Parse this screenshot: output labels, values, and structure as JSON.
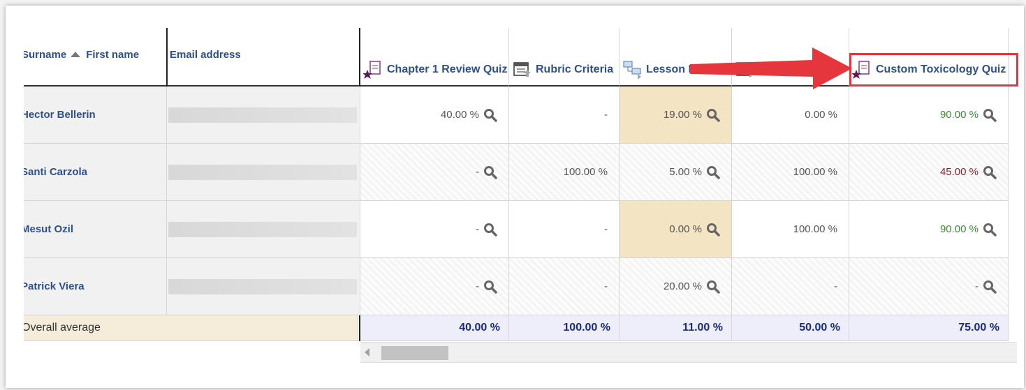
{
  "table": {
    "header": {
      "surname": "Surname",
      "first_name": "First name",
      "email": "Email address",
      "columns": [
        {
          "name": "Chapter 1 Review Quiz",
          "icon": "quiz-icon"
        },
        {
          "name": "Rubric Criteria",
          "icon": "assignment-icon"
        },
        {
          "name": "Lesson Exam",
          "icon": "lesson-icon"
        },
        {
          "name": "",
          "icon": "assignment-icon"
        },
        {
          "name": "Custom Toxicology Quiz",
          "icon": "quiz-icon"
        }
      ]
    },
    "rows": [
      {
        "name": "Hector Bellerin",
        "grades": [
          {
            "value": "40.00 %",
            "mag": true,
            "style": "",
            "bg": "white"
          },
          {
            "value": "-",
            "mag": false,
            "style": "",
            "bg": "white"
          },
          {
            "value": "19.00 %",
            "mag": true,
            "style": "",
            "bg": "highlight"
          },
          {
            "value": "0.00 %",
            "mag": false,
            "style": "",
            "bg": "white"
          },
          {
            "value": "90.00 %",
            "mag": true,
            "style": "green",
            "bg": "white"
          }
        ]
      },
      {
        "name": "Santi Carzola",
        "grades": [
          {
            "value": "-",
            "mag": true,
            "style": "",
            "bg": "hatch"
          },
          {
            "value": "100.00 %",
            "mag": false,
            "style": "",
            "bg": "hatch"
          },
          {
            "value": "5.00 %",
            "mag": true,
            "style": "",
            "bg": "hatch"
          },
          {
            "value": "100.00 %",
            "mag": false,
            "style": "",
            "bg": "hatch"
          },
          {
            "value": "45.00 %",
            "mag": true,
            "style": "red",
            "bg": "hatch"
          }
        ]
      },
      {
        "name": "Mesut Ozil",
        "grades": [
          {
            "value": "-",
            "mag": true,
            "style": "",
            "bg": "white"
          },
          {
            "value": "-",
            "mag": false,
            "style": "",
            "bg": "white"
          },
          {
            "value": "0.00 %",
            "mag": true,
            "style": "",
            "bg": "highlight"
          },
          {
            "value": "100.00 %",
            "mag": false,
            "style": "",
            "bg": "white"
          },
          {
            "value": "90.00 %",
            "mag": true,
            "style": "green",
            "bg": "white"
          }
        ]
      },
      {
        "name": "Patrick Viera",
        "grades": [
          {
            "value": "-",
            "mag": true,
            "style": "",
            "bg": "hatch"
          },
          {
            "value": "-",
            "mag": false,
            "style": "",
            "bg": "hatch"
          },
          {
            "value": "20.00 %",
            "mag": true,
            "style": "",
            "bg": "hatch"
          },
          {
            "value": "-",
            "mag": false,
            "style": "",
            "bg": "hatch"
          },
          {
            "value": "-",
            "mag": true,
            "style": "",
            "bg": "hatch"
          }
        ]
      }
    ],
    "overall": {
      "label": "Overall average",
      "values": [
        "40.00 %",
        "100.00 %",
        "11.00 %",
        "50.00 %",
        "75.00 %"
      ]
    }
  },
  "colors": {
    "link": "#2d4f8c",
    "highlight": "#f3e4c3",
    "annotation": "#e5363d",
    "good_grade": "#3c8a35",
    "low_grade": "#8f1f1f"
  }
}
